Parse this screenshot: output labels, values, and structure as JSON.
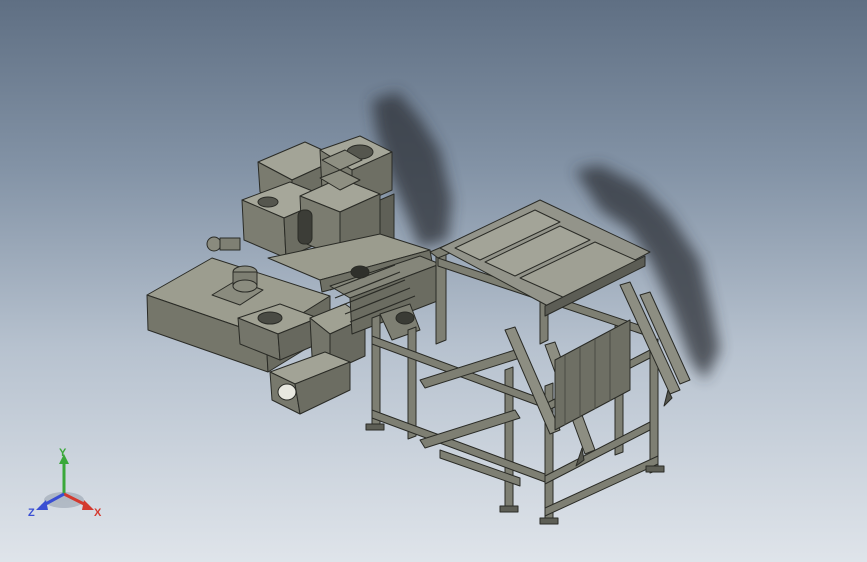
{
  "view": {
    "background_top": "#5f6f83",
    "background_bottom": "#dfe4ea",
    "model_color": "#8a8b7c",
    "frame_color": "#7d7e72",
    "shadow_color": "#2f3137"
  },
  "triad": {
    "y_label": "Y",
    "x_label": "X",
    "z_label": "Z",
    "y_color": "#3aa83a",
    "x_color": "#d33a2f",
    "z_color": "#3a4fd3"
  }
}
